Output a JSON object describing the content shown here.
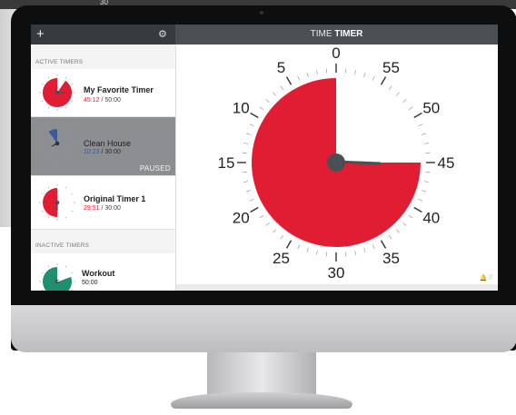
{
  "background_label": "30",
  "header": {
    "add_icon": "+",
    "settings_icon": "⚙",
    "title_prefix": "TIME ",
    "title_brand": "TIMER"
  },
  "sidebar": {
    "active_label": "ACTIVE TIMERS",
    "inactive_label": "INACTIVE TIMERS",
    "active_timers": [
      {
        "name": "My Favorite Timer",
        "elapsed": "45:12",
        "total": " / 50:00",
        "color": "#e11d34",
        "fraction": 0.904
      },
      {
        "name": "Clean House",
        "elapsed": "10:23",
        "total": " / 30:00",
        "color": "#3d5a96",
        "fraction": 0.1,
        "status": "PAUSED"
      },
      {
        "name": "Original Timer 1",
        "elapsed": "29:51",
        "total": " / 30:00",
        "color": "#e11d34",
        "fraction": 0.5
      }
    ],
    "inactive_timers": [
      {
        "name": "Workout",
        "total": "50:00",
        "color": "#1f8f70",
        "fraction": 0.8
      }
    ]
  },
  "main_dial": {
    "color": "#e11d34",
    "minutes_remaining": 45,
    "scale_labels": [
      "0",
      "5",
      "10",
      "15",
      "20",
      "25",
      "30",
      "35",
      "40",
      "45",
      "50",
      "55"
    ],
    "corner_icons": "🔔 //"
  }
}
